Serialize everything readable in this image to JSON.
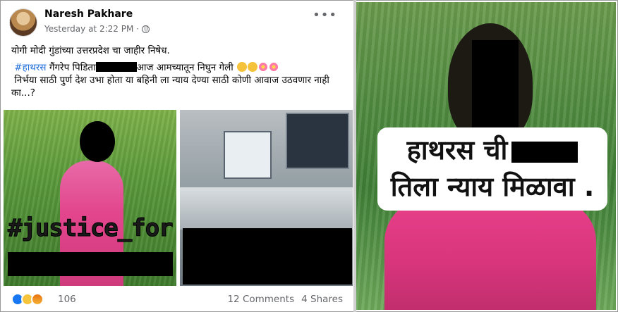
{
  "post": {
    "author": "Naresh Pakhare",
    "time": "Yesterday at 2:22 PM",
    "separator": "·",
    "more": "•••",
    "text_line1": "योगी मोदी गुंडांच्या उत्तरप्रदेश चा जाहीर निषेध.",
    "hashtag": "#हाथरस",
    "text_part2": " गैंगरेप पिडिता",
    "text_part3": "आज आमच्यातून निघुन गेली",
    "text_part4": "निर्भया साठी पुर्ण  देश उभा होता या बहिनी ला न्याय देण्या साठी कोणी आवाज उठवणार नाही का...?",
    "image_left_text": "#justice_for",
    "reaction_count": "106",
    "comments": "12 Comments",
    "shares": "4 Shares"
  },
  "poster": {
    "line1": "हाथरस ची",
    "line2": "तिला न्याय मिळावा ."
  },
  "colors": {
    "hashtag": "#216fdb",
    "like": "#1877f2",
    "muted": "#65676b"
  }
}
